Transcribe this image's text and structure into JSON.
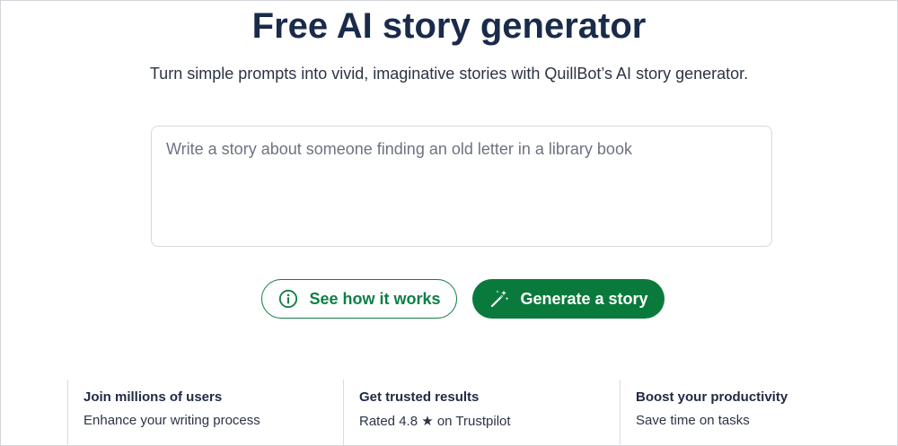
{
  "hero": {
    "title": "Free AI story generator",
    "subtitle": "Turn simple prompts into vivid, imaginative stories with QuillBot’s AI story generator."
  },
  "prompt": {
    "placeholder": "Write a story about someone finding an old letter in a library book",
    "value": ""
  },
  "actions": {
    "see_how_label": "See how it works",
    "see_how_icon": "info-circle-icon",
    "generate_label": "Generate a story",
    "generate_icon": "magic-wand-icon"
  },
  "features": [
    {
      "title": "Join millions of users",
      "description": "Enhance your writing process"
    },
    {
      "title": "Get trusted results",
      "description": "Rated 4.8 ★ on Trustpilot"
    },
    {
      "title": "Boost your productivity",
      "description": "Save time on tasks"
    }
  ],
  "colors": {
    "brand_green": "#0a7a3c",
    "title_navy": "#1a2b4a",
    "border_gray": "#d5d9df"
  }
}
